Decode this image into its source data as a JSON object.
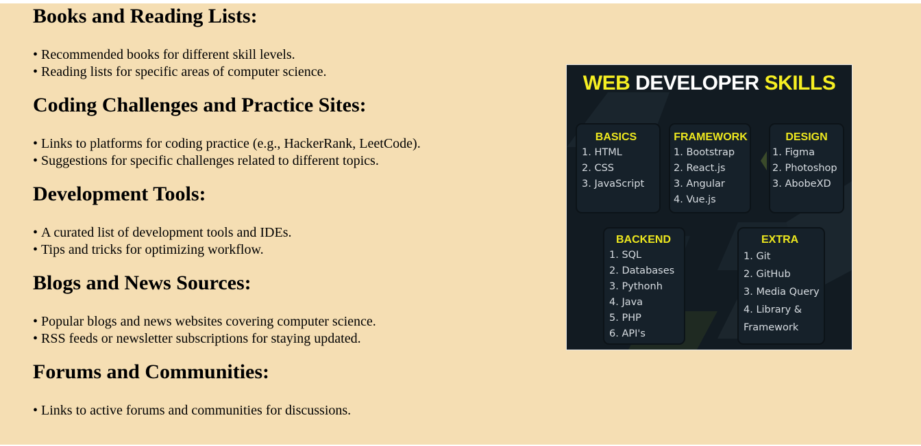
{
  "sections": [
    {
      "heading": "Books and Reading Lists:",
      "items": [
        "Recommended books for different skill levels.",
        "Reading lists for specific areas of computer science."
      ]
    },
    {
      "heading": "Coding Challenges and Practice Sites:",
      "items": [
        "Links to platforms for coding practice (e.g., HackerRank, LeetCode).",
        "Suggestions for specific challenges related to different topics."
      ]
    },
    {
      "heading": "Development Tools:",
      "items": [
        "A curated list of development tools and IDEs.",
        "Tips and tricks for optimizing workflow."
      ]
    },
    {
      "heading": "Blogs and News Sources:",
      "items": [
        "Popular blogs and news websites covering computer science.",
        "RSS feeds or newsletter subscriptions for staying updated."
      ]
    },
    {
      "heading": "Forums and Communities:",
      "items": [
        "Links to active forums and communities for discussions."
      ]
    }
  ],
  "poster": {
    "title_part1": "WEB",
    "title_part2": "DEVELOPER",
    "title_part3": "SKILLS",
    "colors": {
      "background": "#121b22",
      "accent_yellow": "#f6ef22",
      "text_light": "#d8dde2"
    },
    "basics": {
      "heading": "BASICS",
      "items": [
        "1. HTML",
        "2. CSS",
        "3. JavaScript"
      ]
    },
    "framework": {
      "heading": "FRAMEWORK",
      "items": [
        "1. Bootstrap",
        "2. React.js",
        "3. Angular",
        "4. Vue.js"
      ]
    },
    "design": {
      "heading": "DESIGN",
      "items": [
        "1. Figma",
        "2. Photoshop",
        "3. AbobeXD"
      ]
    },
    "backend": {
      "heading": "BACKEND",
      "items": [
        "1. SQL",
        "2. Databases",
        "3. Pythonh",
        "4. Java",
        "5. PHP",
        "6. API's"
      ]
    },
    "extra": {
      "heading": "EXTRA",
      "items": [
        "1. Git",
        "2. GitHub",
        "3. Media Query",
        "4. Library &",
        "Framework"
      ]
    }
  }
}
